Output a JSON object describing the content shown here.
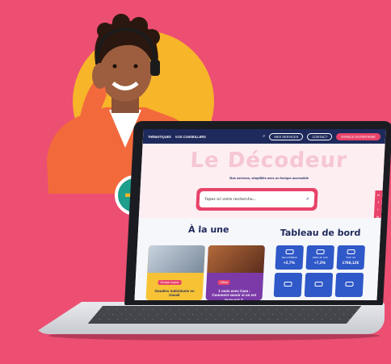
{
  "nav": {
    "items": [
      "THÉMATIQUES",
      "VOS CONSEILLERS"
    ],
    "pills": [
      "MES SERVICES",
      "CONTACT",
      "ESPACE ENTREPRISE"
    ]
  },
  "hero": {
    "title": "Le Décodeur",
    "subtitle": "Nos services, simplifiés avec un lexique accessible",
    "search_placeholder": "Tapez ici votre recherche...",
    "social_icons": [
      "in",
      "f",
      "t",
      "ig",
      "yt"
    ]
  },
  "sections": {
    "a_la_une": "À la une",
    "tableau_de_bord": "Tableau de bord"
  },
  "cards": [
    {
      "tag": "Dossier expert",
      "title": "Goodies individuels en travail"
    },
    {
      "tag": "Débat",
      "title": "1 mois avec Cara : Comment savoir si on est burn-out ?"
    }
  ],
  "dashboard": [
    {
      "label": "Taux d'inflation",
      "value": "+3,7%"
    },
    {
      "label": "Indice du coût",
      "value": "+7,2%"
    },
    {
      "label": "Smic net",
      "value": "1766,12€"
    },
    {
      "label": "",
      "value": ""
    },
    {
      "label": "",
      "value": ""
    },
    {
      "label": "",
      "value": ""
    }
  ],
  "colors": {
    "background": "#ec4f72",
    "navy": "#1f2a5c",
    "pink": "#e8436a",
    "yellow": "#f7b52a",
    "teal": "#1e9e8c",
    "blue_card": "#2f58c8"
  },
  "badge_icon": "plus-icon"
}
